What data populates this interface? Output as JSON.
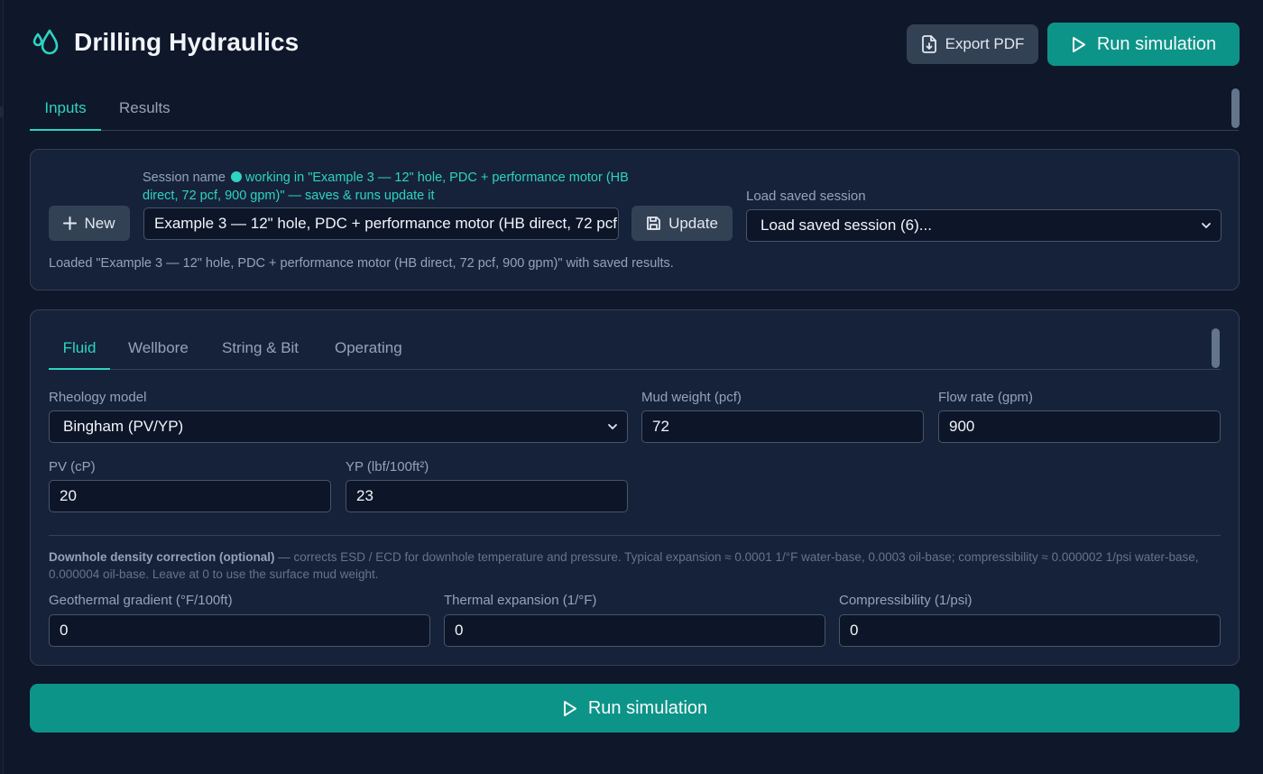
{
  "app": {
    "title": "Drilling Hydraulics",
    "export_label": "Export PDF",
    "run_label": "Run simulation",
    "accent": "#0d9488",
    "accent_text": "#2dd4bf"
  },
  "main_tabs": [
    {
      "label": "Inputs",
      "active": true
    },
    {
      "label": "Results",
      "active": false
    }
  ],
  "session": {
    "new_label": "New",
    "name_label": "Session name",
    "status": "working in \"Example 3 — 12\" hole, PDC + performance motor (HB direct, 72 pcf, 900 gpm)\" — saves & runs update it",
    "name_value": "Example 3 — 12\" hole, PDC + performance motor (HB direct, 72 pcf, 900 gpm)",
    "update_label": "Update",
    "load_label": "Load saved session",
    "load_value": "Load saved session (6)...",
    "info": "Loaded \"Example 3 — 12\" hole, PDC + performance motor (HB direct, 72 pcf, 900 gpm)\" with saved results."
  },
  "sub_tabs": [
    {
      "label": "Fluid",
      "active": true
    },
    {
      "label": "Wellbore",
      "active": false
    },
    {
      "label": "String & Bit",
      "active": false
    },
    {
      "label": "Operating",
      "active": false
    }
  ],
  "fluid": {
    "rheology_label": "Rheology model",
    "rheology_value": "Bingham (PV/YP)",
    "mud_weight_label": "Mud weight (pcf)",
    "mud_weight_value": "72",
    "flow_rate_label": "Flow rate (gpm)",
    "flow_rate_value": "900",
    "pv_label": "PV (cP)",
    "pv_value": "20",
    "yp_label": "YP (lbf/100ft²)",
    "yp_value": "23"
  },
  "density": {
    "title": "Downhole density correction (optional)",
    "text": " — corrects ESD / ECD for downhole temperature and pressure. Typical expansion ≈ 0.0001 1/°F water-base, 0.0003 oil-base; compressibility ≈ 0.000002 1/psi water-base, 0.000004 oil-base. Leave at 0 to use the surface mud weight.",
    "geo_label": "Geothermal gradient (°F/100ft)",
    "geo_value": "0",
    "thermal_label": "Thermal expansion (1/°F)",
    "thermal_value": "0",
    "comp_label": "Compressibility (1/psi)",
    "comp_value": "0"
  }
}
